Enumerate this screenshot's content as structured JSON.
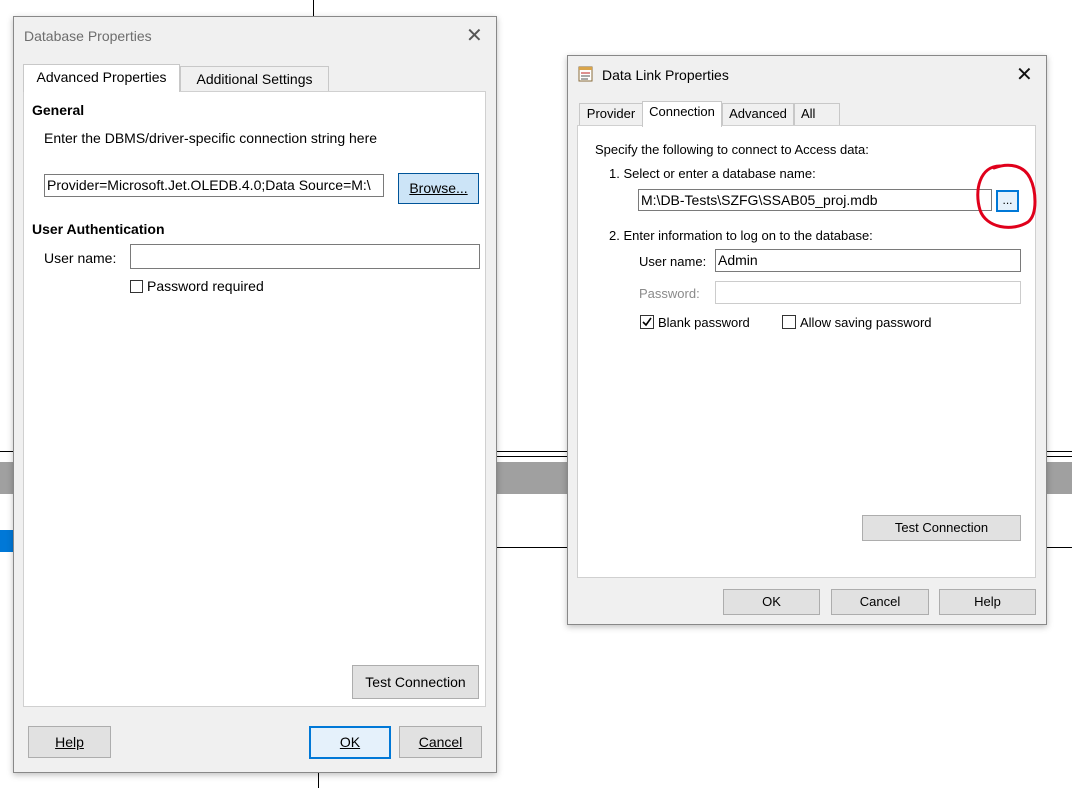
{
  "db_props": {
    "title": "Database Properties",
    "tabs": [
      {
        "label": "Advanced Properties"
      },
      {
        "label": "Additional Settings"
      }
    ],
    "general_heading": "General",
    "conn_string_label": "Enter the DBMS/driver-specific connection string here",
    "conn_string_value": "Provider=Microsoft.Jet.OLEDB.4.0;Data Source=M:\\",
    "browse_label": "Browse...",
    "auth_heading": "User Authentication",
    "user_name_label": "User name:",
    "user_name_value": "",
    "password_required_label": "Password required",
    "password_required_checked": false,
    "test_connection_label": "Test Connection",
    "help_label": "Help",
    "ok_label": "OK",
    "cancel_label": "Cancel"
  },
  "data_link": {
    "title": "Data Link Properties",
    "tabs": [
      {
        "label": "Provider"
      },
      {
        "label": "Connection"
      },
      {
        "label": "Advanced"
      },
      {
        "label": "All"
      }
    ],
    "active_tab": "Connection",
    "intro": "Specify the following to connect to Access data:",
    "step1_label": "1. Select or enter a database name:",
    "db_name_value": "M:\\DB-Tests\\SZFG\\SSAB05_proj.mdb",
    "browse_ellipsis": "...",
    "step2_label": "2. Enter information to log on to the database:",
    "user_name_label": "User name:",
    "user_name_value": "Admin",
    "password_label": "Password:",
    "password_value": "",
    "blank_password_label": "Blank password",
    "blank_password_checked": true,
    "allow_saving_label": "Allow saving password",
    "allow_saving_checked": false,
    "test_connection_label": "Test Connection",
    "ok_label": "OK",
    "cancel_label": "Cancel",
    "help_label": "Help"
  },
  "annotation_color": "#e0001b",
  "accent_color": "#0078d7"
}
